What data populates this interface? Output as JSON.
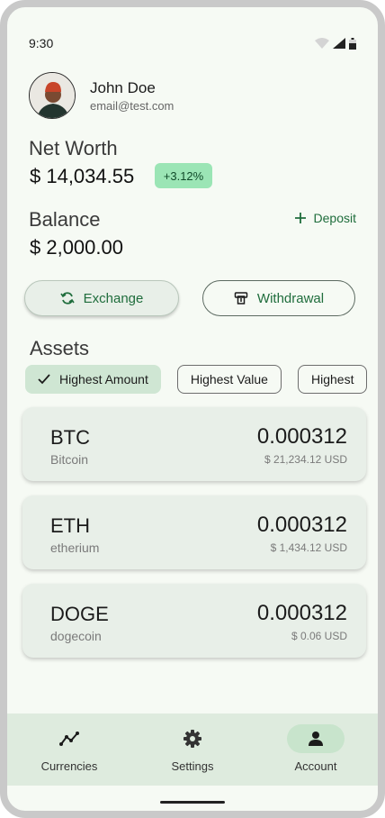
{
  "status_bar": {
    "time": "9:30"
  },
  "profile": {
    "name": "John Doe",
    "email": "email@test.com"
  },
  "net_worth": {
    "label": "Net Worth",
    "value": "$ 14,034.55",
    "change": "+3.12%"
  },
  "balance": {
    "label": "Balance",
    "value": "$ 2,000.00",
    "deposit_label": "Deposit"
  },
  "actions": {
    "exchange_label": "Exchange",
    "withdrawal_label": "Withdrawal"
  },
  "assets": {
    "title": "Assets",
    "filters": [
      "Highest Amount",
      "Highest Value",
      "Highest"
    ],
    "active_filter_index": 0,
    "items": [
      {
        "symbol": "BTC",
        "name": "Bitcoin",
        "amount": "0.000312",
        "usd": "$ 21,234.12 USD"
      },
      {
        "symbol": "ETH",
        "name": "etherium",
        "amount": "0.000312",
        "usd": "$ 1,434.12 USD"
      },
      {
        "symbol": "DOGE",
        "name": "dogecoin",
        "amount": "0.000312",
        "usd": "$ 0.06 USD"
      }
    ]
  },
  "bottom_nav": {
    "items": [
      {
        "label": "Currencies",
        "icon": "chart-line-icon"
      },
      {
        "label": "Settings",
        "icon": "gear-icon"
      },
      {
        "label": "Account",
        "icon": "person-icon"
      }
    ],
    "active_index": 2
  },
  "colors": {
    "accent": "#1f6d3c",
    "badge_bg": "#9be5b5",
    "card_bg": "#e8efe8",
    "nav_bg": "#deebde"
  }
}
